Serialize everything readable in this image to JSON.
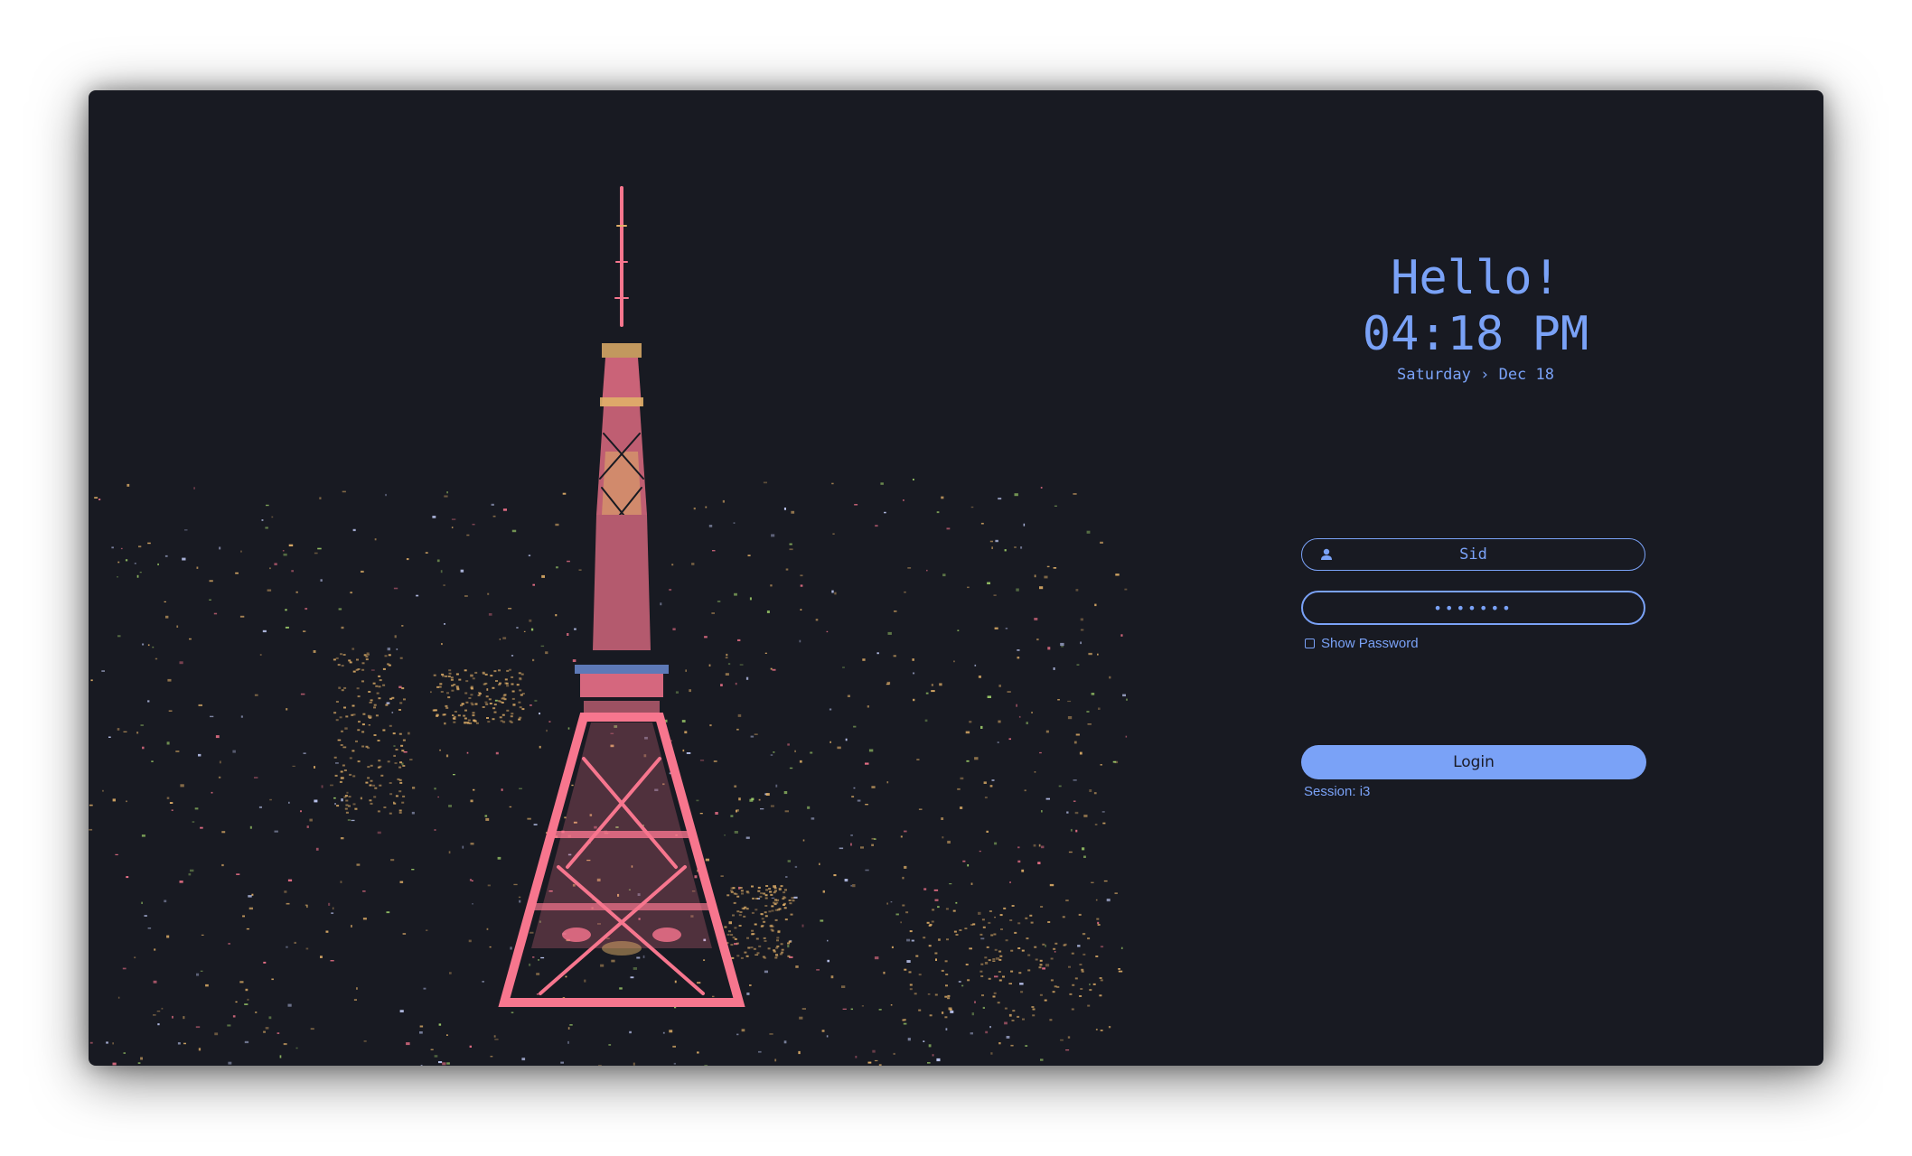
{
  "greeter": {
    "greeting": "Hello!",
    "time": "04:18 PM",
    "date": "Saturday › Dec 18"
  },
  "login_form": {
    "username": "Sid",
    "password_masked": "•••••••",
    "show_password_label": "Show Password",
    "show_password_checked": false,
    "login_label": "Login",
    "session": "Session: i3"
  },
  "colors": {
    "accent": "#7aa2f7",
    "background": "#181a22",
    "button_text": "#1a1b26",
    "tower": "#f7768e",
    "lights": "#e0af68"
  },
  "icons": {
    "user": "user-icon"
  }
}
